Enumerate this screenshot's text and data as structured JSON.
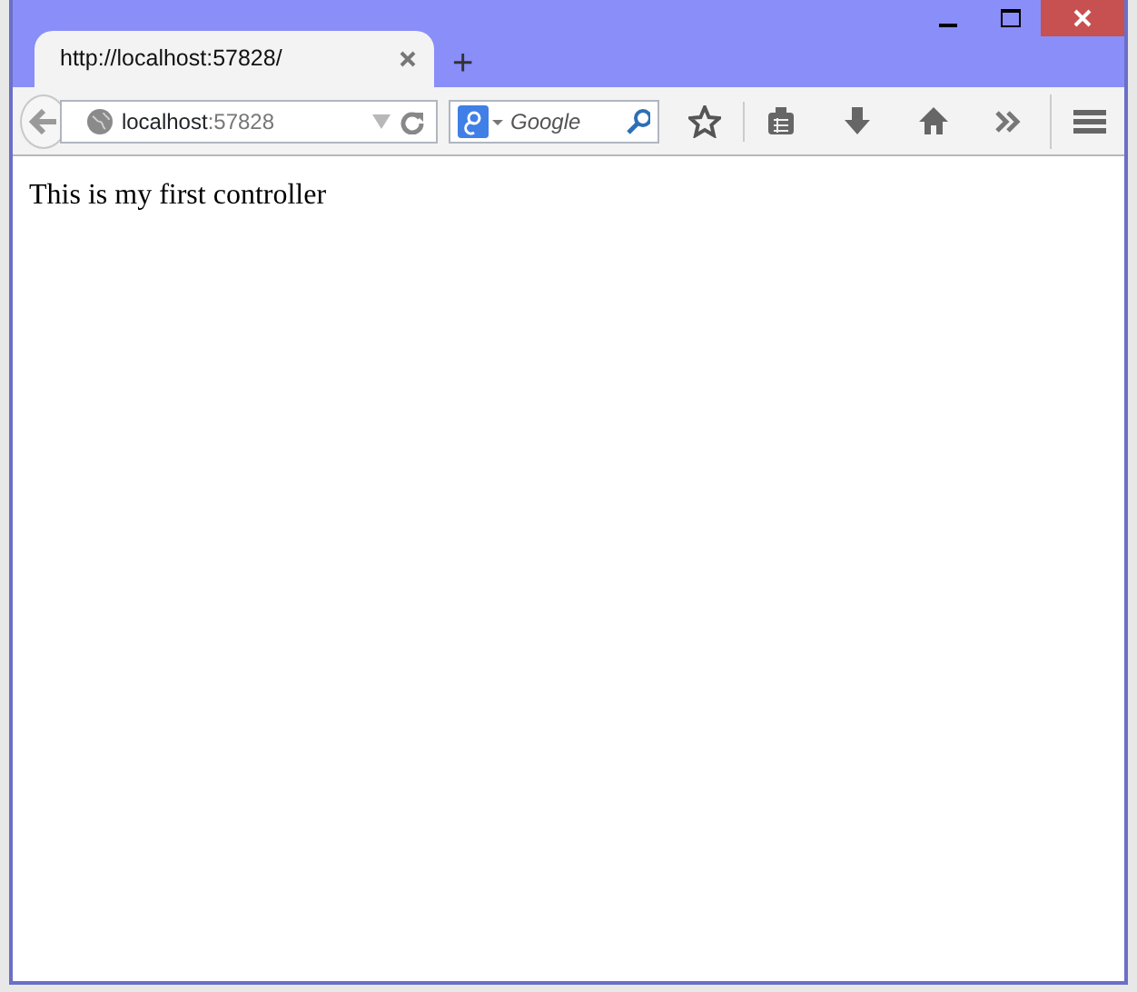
{
  "tabs": [
    {
      "title": "http://localhost:57828/",
      "selected": true
    }
  ],
  "new_tab": "+",
  "address_bar": {
    "host": "localhost",
    "port": ":57828"
  },
  "search": {
    "placeholder": "Google"
  },
  "page": {
    "text": "This is my first controller"
  }
}
